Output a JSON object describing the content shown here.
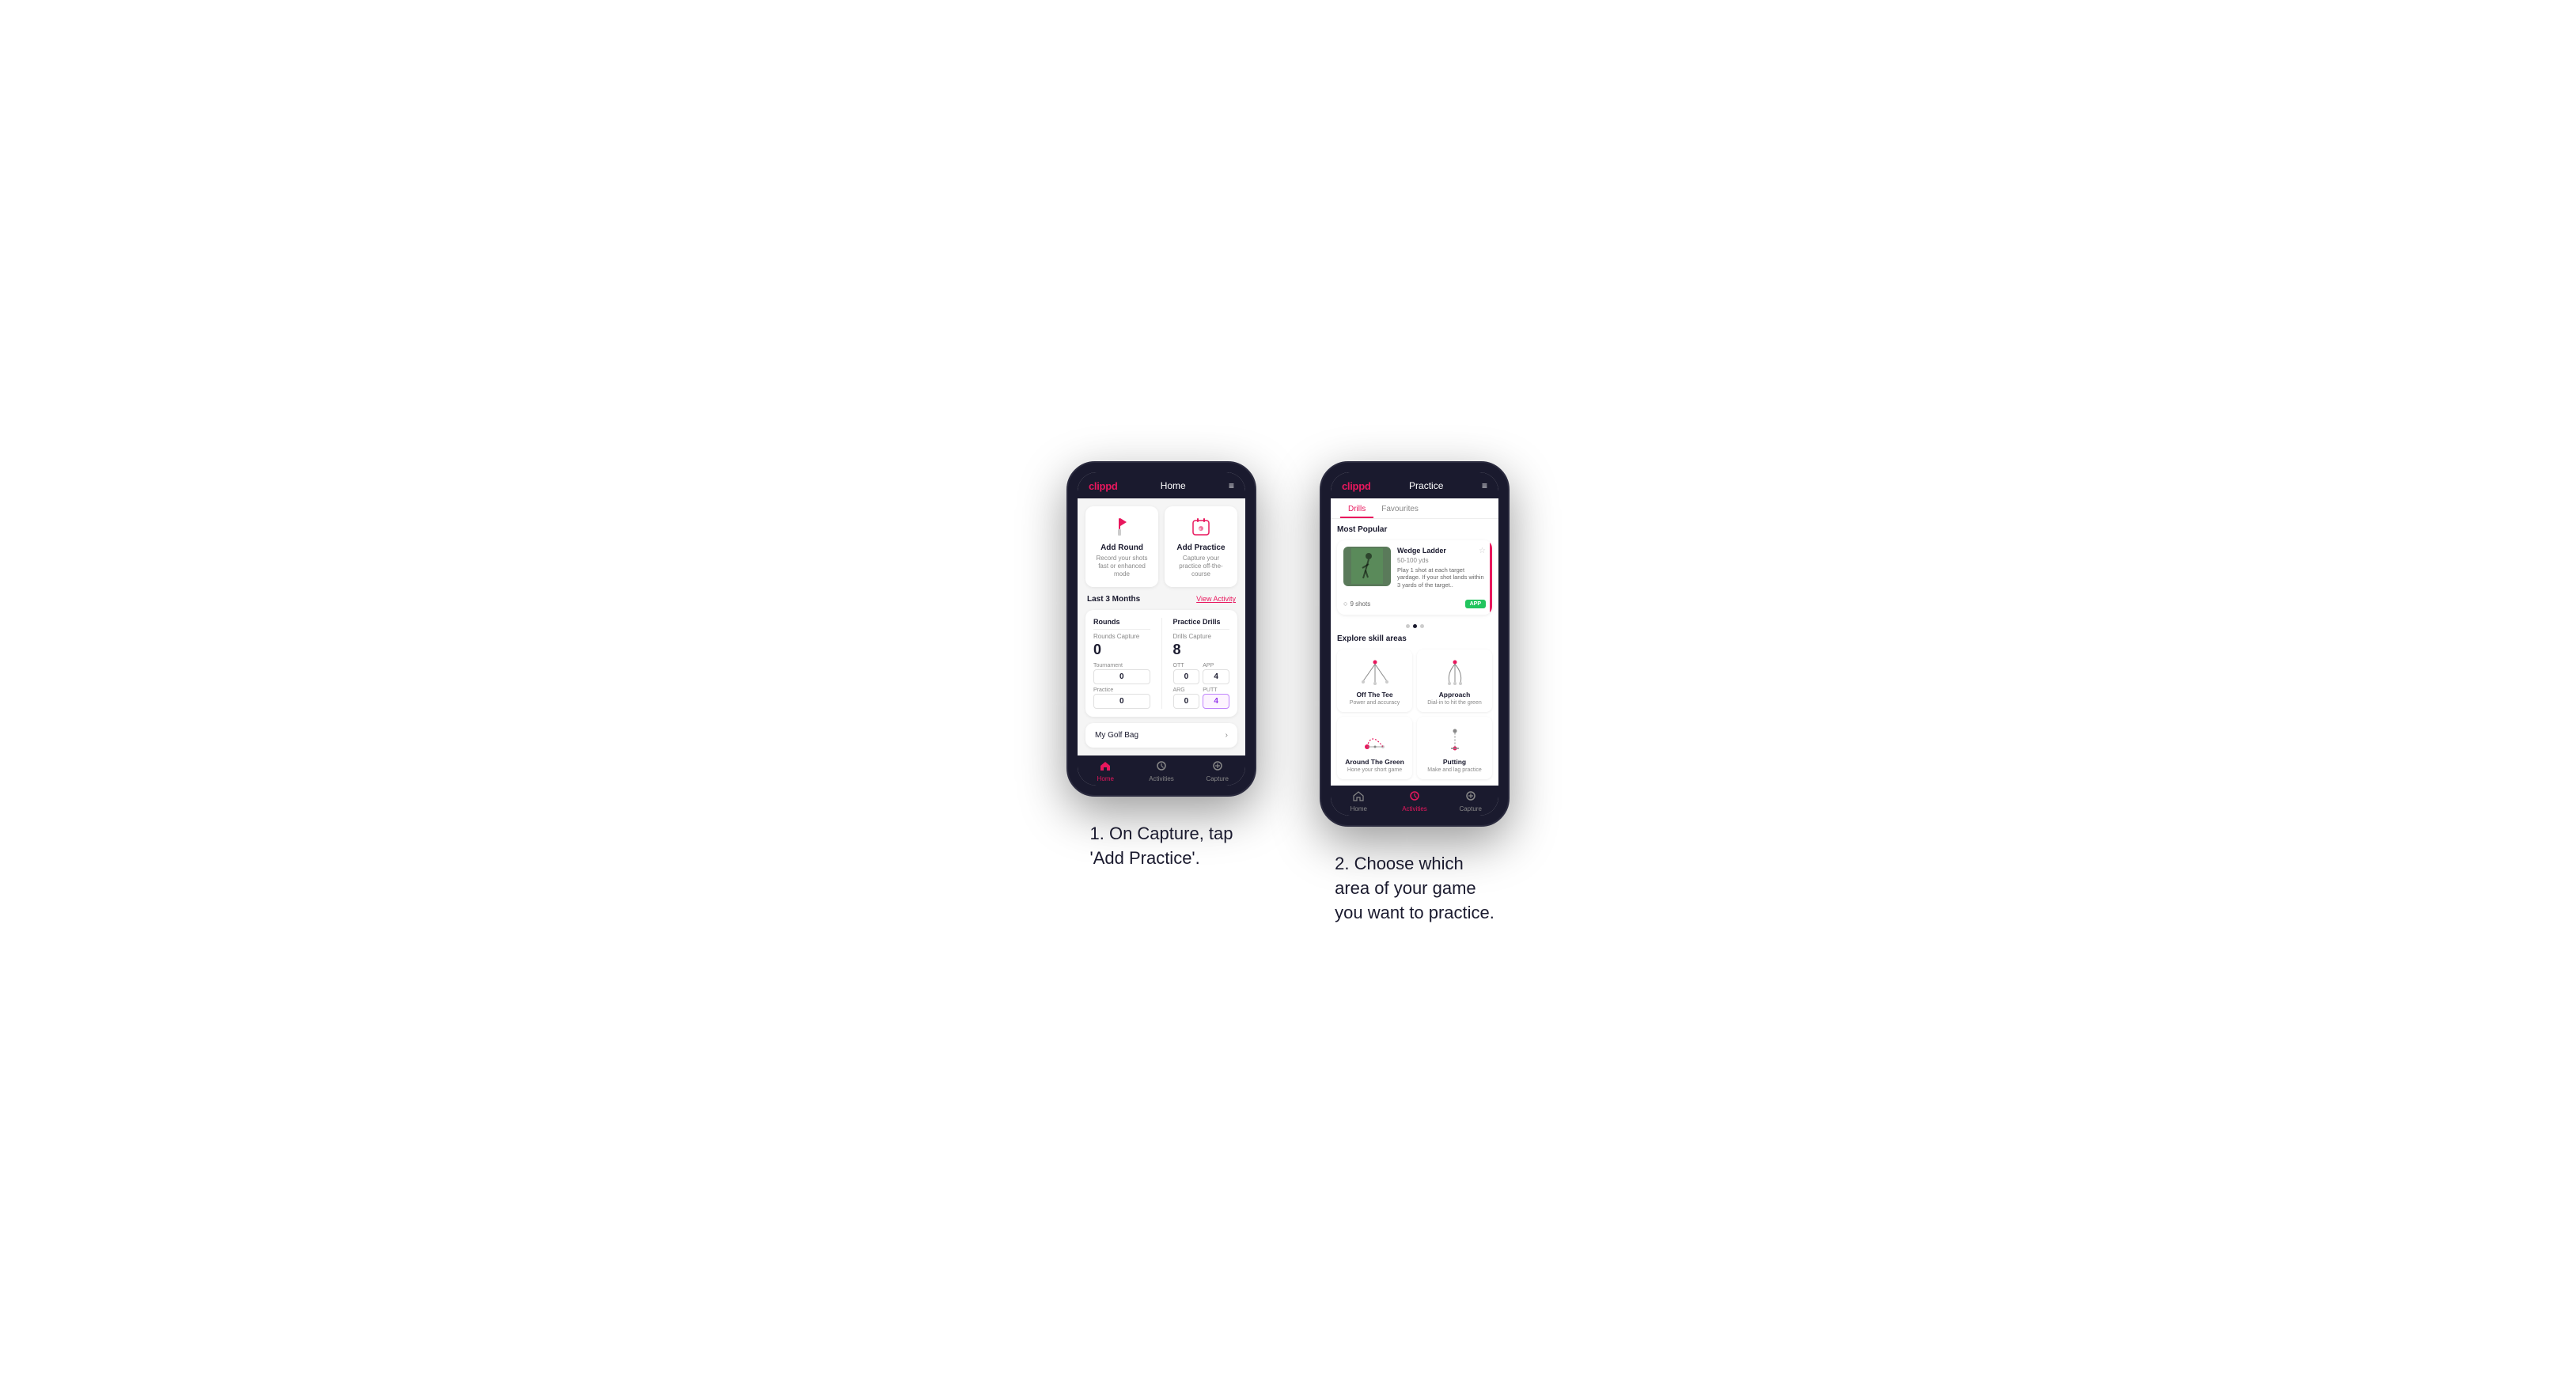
{
  "phone1": {
    "header": {
      "logo": "clippd",
      "title": "Home",
      "menu_icon": "≡"
    },
    "action_cards": [
      {
        "id": "add-round",
        "title": "Add Round",
        "desc": "Record your shots fast or enhanced mode",
        "icon": "flag"
      },
      {
        "id": "add-practice",
        "title": "Add Practice",
        "desc": "Capture your practice off-the-course",
        "icon": "calendar"
      }
    ],
    "activity_section": {
      "label": "Last 3 Months",
      "link": "View Activity"
    },
    "stats": {
      "rounds": {
        "title": "Rounds",
        "rounds_capture_label": "Rounds Capture",
        "rounds_capture_value": "0",
        "tournament_label": "Tournament",
        "tournament_value": "0",
        "practice_label": "Practice",
        "practice_value": "0"
      },
      "practice_drills": {
        "title": "Practice Drills",
        "drills_capture_label": "Drills Capture",
        "drills_capture_value": "8",
        "ott_label": "OTT",
        "ott_value": "0",
        "app_label": "APP",
        "app_value": "4",
        "arg_label": "ARG",
        "arg_value": "0",
        "putt_label": "PUTT",
        "putt_value": "4"
      }
    },
    "golf_bag": {
      "label": "My Golf Bag"
    },
    "bottom_nav": [
      {
        "id": "home",
        "label": "Home",
        "icon": "⌂",
        "active": true
      },
      {
        "id": "activities",
        "label": "Activities",
        "icon": "⊕",
        "active": false
      },
      {
        "id": "capture",
        "label": "Capture",
        "icon": "⊕",
        "active": false
      }
    ]
  },
  "phone2": {
    "header": {
      "logo": "clippd",
      "title": "Practice",
      "menu_icon": "≡"
    },
    "tabs": [
      {
        "id": "drills",
        "label": "Drills",
        "active": true
      },
      {
        "id": "favourites",
        "label": "Favourites",
        "active": false
      }
    ],
    "most_popular": {
      "section_label": "Most Popular",
      "card": {
        "title": "Wedge Ladder",
        "yds": "50-100 yds",
        "desc": "Play 1 shot at each target yardage. If your shot lands within 3 yards of the target..",
        "shots": "9 shots",
        "badge": "APP"
      }
    },
    "explore": {
      "section_label": "Explore skill areas",
      "skills": [
        {
          "id": "off-the-tee",
          "title": "Off The Tee",
          "desc": "Power and accuracy",
          "diagram": "ott"
        },
        {
          "id": "approach",
          "title": "Approach",
          "desc": "Dial-in to hit the green",
          "diagram": "approach"
        },
        {
          "id": "around-the-green",
          "title": "Around The Green",
          "desc": "Hone your short game",
          "diagram": "atg"
        },
        {
          "id": "putting",
          "title": "Putting",
          "desc": "Make and lag practice",
          "diagram": "putting"
        }
      ]
    },
    "bottom_nav": [
      {
        "id": "home",
        "label": "Home",
        "icon": "⌂",
        "active": false
      },
      {
        "id": "activities",
        "label": "Activities",
        "icon": "⊕",
        "active": true
      },
      {
        "id": "capture",
        "label": "Capture",
        "icon": "⊕",
        "active": false
      }
    ]
  },
  "captions": {
    "caption1": "1. On Capture, tap\n'Add Practice'.",
    "caption2": "2. Choose which\narea of your game\nyou want to practice."
  },
  "colors": {
    "brand": "#e8175d",
    "dark": "#1a1a2e",
    "green": "#22c55e",
    "purple": "#9333ea",
    "purple_border": "#c084fc"
  }
}
